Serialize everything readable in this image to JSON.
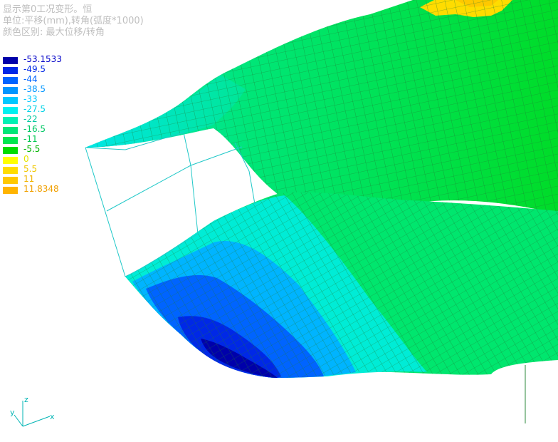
{
  "header": {
    "line1": "显示第0工况变形。恒",
    "line2": "单位:平移(mm),转角(弧度*1000)",
    "line3": "颜色区别: 最大位移/转角"
  },
  "legend": {
    "items": [
      {
        "label": "-53.1533",
        "color": "#0000aa",
        "text_color": "#0000c8"
      },
      {
        "label": "-49.5",
        "color": "#0028e6",
        "text_color": "#0028e6"
      },
      {
        "label": "-44",
        "color": "#0064ff",
        "text_color": "#0064ff"
      },
      {
        "label": "-38.5",
        "color": "#0096ff",
        "text_color": "#0096ff"
      },
      {
        "label": "-33",
        "color": "#00c8ff",
        "text_color": "#00c8ff"
      },
      {
        "label": "-27.5",
        "color": "#00f0f0",
        "text_color": "#00d2e6"
      },
      {
        "label": "-22",
        "color": "#00f0b4",
        "text_color": "#00c8a0"
      },
      {
        "label": "-16.5",
        "color": "#00e678",
        "text_color": "#00c864"
      },
      {
        "label": "-11",
        "color": "#00e650",
        "text_color": "#00c850"
      },
      {
        "label": "-5.5",
        "color": "#00dc00",
        "text_color": "#00b400"
      },
      {
        "label": "0",
        "color": "#ffff00",
        "text_color": "#e6e600"
      },
      {
        "label": "5.5",
        "color": "#ffdc00",
        "text_color": "#f0c800"
      },
      {
        "label": "11",
        "color": "#ffc800",
        "text_color": "#f0b400"
      },
      {
        "label": "11.8348",
        "color": "#ffb400",
        "text_color": "#f0a000"
      }
    ]
  },
  "axes": {
    "x": "x",
    "y": "y",
    "z": "z"
  },
  "colors": {
    "mesh_line": "#2d8a3c",
    "frame_line": "#20c8c8",
    "background": "#ffffff"
  }
}
